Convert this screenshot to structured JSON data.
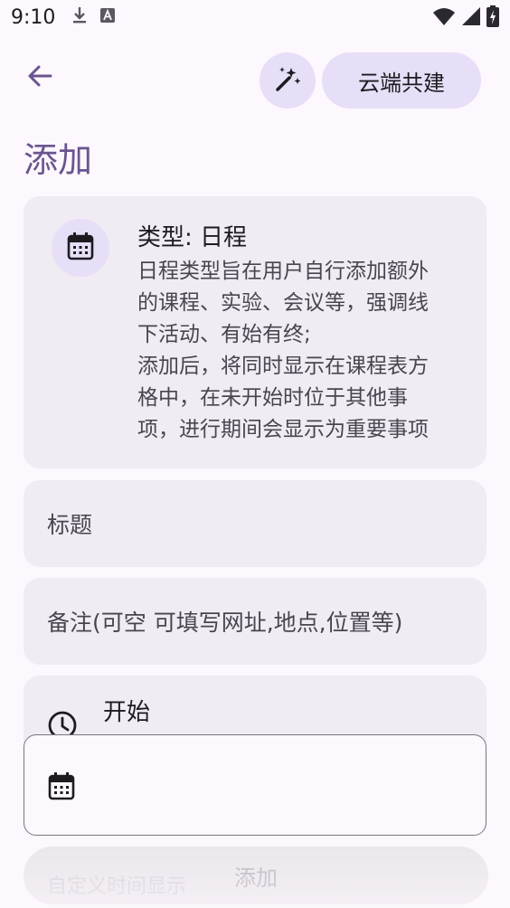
{
  "status_bar": {
    "time": "9:10"
  },
  "topbar": {
    "back_icon": "arrow-back-icon",
    "magic_icon": "auto-fix-icon",
    "cloud_button_label": "云端共建"
  },
  "page": {
    "title": "添加"
  },
  "info_card": {
    "icon": "calendar-icon",
    "type_label": "类型: 日程",
    "description_lines": [
      "日程类型旨在用户自行添加额外",
      "的课程、实验、会议等，强调线",
      "下活动、有始有终;",
      "添加后，将同时显示在课程表方",
      "格中，在未开始时位于其他事",
      "项，进行期间会显示为重要事项"
    ]
  },
  "fields": {
    "title_placeholder": "标题",
    "note_placeholder": "备注(可空 可填写网址,地点,位置等)"
  },
  "start": {
    "label": "开始",
    "icon": "clock-icon"
  },
  "date_picker": {
    "icon": "calendar-icon",
    "value": ""
  },
  "submit": {
    "label": "添加",
    "underlay_text": "自定义时间显示"
  },
  "colors": {
    "background": "#fdf7fe",
    "accent": "#6a558f",
    "tonal": "#e7def7",
    "surface_container": "#f1ebf3"
  }
}
